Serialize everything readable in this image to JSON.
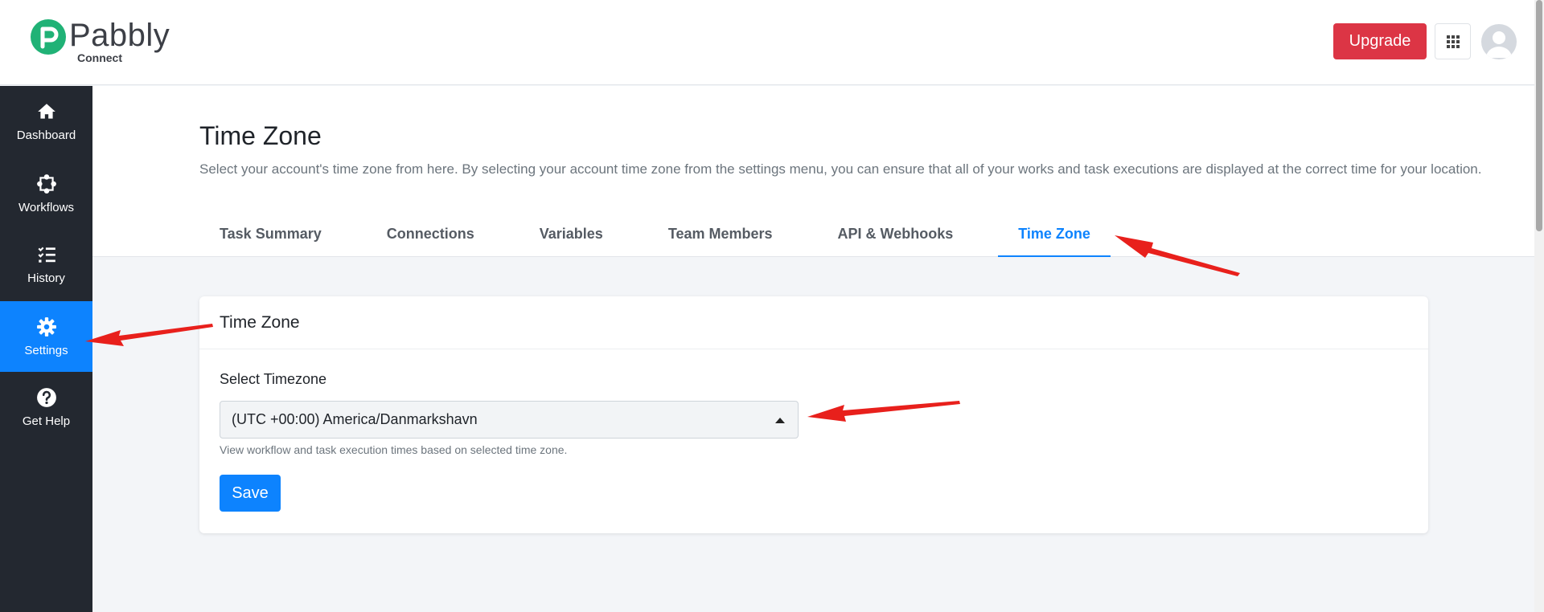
{
  "header": {
    "logo_word": "Pabbly",
    "logo_sub": "Connect",
    "upgrade_label": "Upgrade",
    "apps_icon": "grid-icon",
    "avatar_icon": "user-avatar-icon"
  },
  "sidebar": {
    "items": [
      {
        "label": "Dashboard",
        "icon": "home-icon",
        "active": false
      },
      {
        "label": "Workflows",
        "icon": "workflow-icon",
        "active": false
      },
      {
        "label": "History",
        "icon": "checklist-icon",
        "active": false
      },
      {
        "label": "Settings",
        "icon": "gear-icon",
        "active": true
      },
      {
        "label": "Get Help",
        "icon": "question-icon",
        "active": false
      }
    ]
  },
  "page": {
    "title": "Time Zone",
    "description": "Select your account's time zone from here. By selecting your account time zone from the settings menu, you can ensure that all of your works and task executions are displayed at the correct time for your location.",
    "tabs": [
      {
        "label": "Task Summary",
        "active": false
      },
      {
        "label": "Connections",
        "active": false
      },
      {
        "label": "Variables",
        "active": false
      },
      {
        "label": "Team Members",
        "active": false
      },
      {
        "label": "API & Webhooks",
        "active": false
      },
      {
        "label": "Time Zone",
        "active": true
      }
    ]
  },
  "card": {
    "title": "Time Zone",
    "field_label": "Select Timezone",
    "selected_timezone": "(UTC +00:00) America/Danmarkshavn",
    "help_text": "View workflow and task execution times based on selected time zone.",
    "save_label": "Save"
  },
  "colors": {
    "primary": "#0d83fe",
    "danger": "#dc3545",
    "sidebar": "#232830",
    "annotation": "#e8201c"
  }
}
